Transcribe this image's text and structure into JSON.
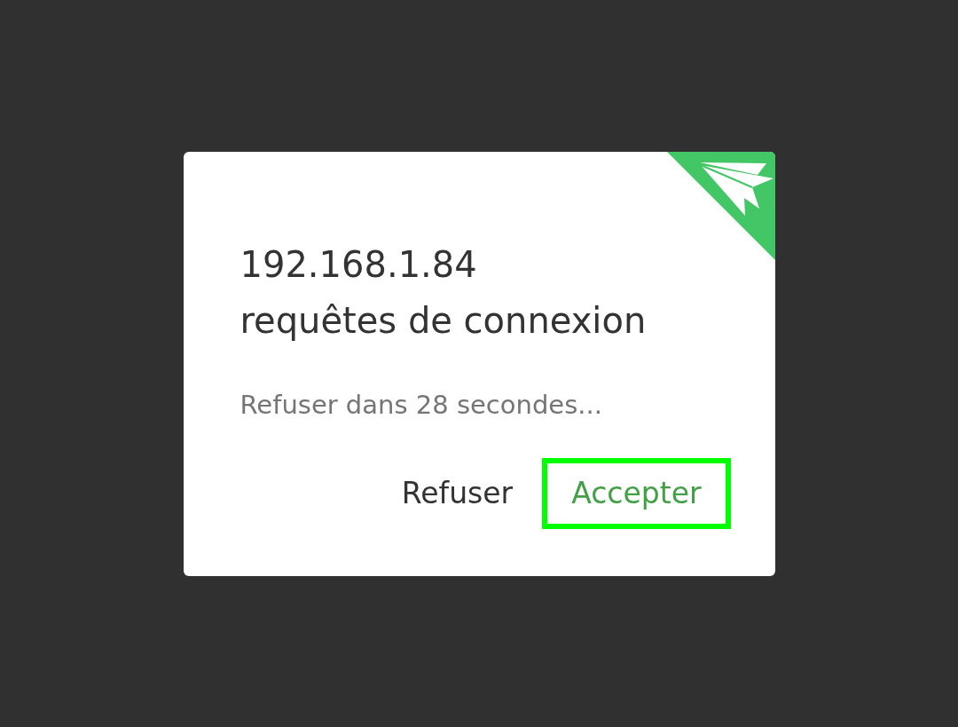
{
  "dialog": {
    "title_lines": [
      "192.168.1.84",
      "requêtes de connexion"
    ],
    "message": "Refuser dans 28 secondes...",
    "buttons": [
      {
        "label": "Refuser",
        "kind": "negative",
        "highlighted": false
      },
      {
        "label": "Accepter",
        "kind": "positive",
        "highlighted": true
      }
    ]
  }
}
